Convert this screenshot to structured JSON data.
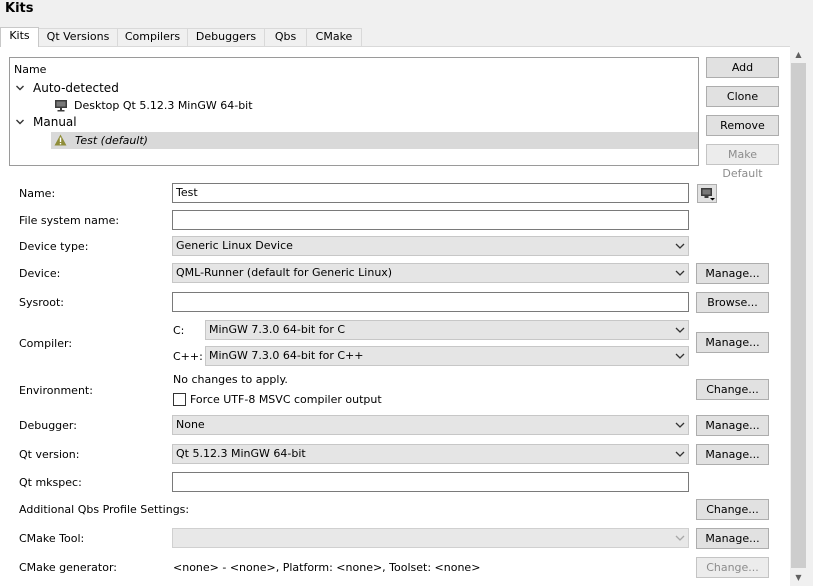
{
  "page": {
    "title": "Kits"
  },
  "tabs": [
    {
      "label": "Kits"
    },
    {
      "label": "Qt Versions"
    },
    {
      "label": "Compilers"
    },
    {
      "label": "Debuggers"
    },
    {
      "label": "Qbs"
    },
    {
      "label": "CMake"
    }
  ],
  "tree": {
    "header": "Name",
    "groups": [
      {
        "label": "Auto-detected",
        "items": [
          {
            "label": "Desktop Qt 5.12.3 MinGW 64-bit",
            "icon": "monitor-icon"
          }
        ]
      },
      {
        "label": "Manual",
        "items": [
          {
            "label": "Test (default)",
            "icon": "warning-icon",
            "selected": true
          }
        ]
      }
    ]
  },
  "actions": {
    "add": "Add",
    "clone": "Clone",
    "remove": "Remove",
    "make_default": "Make Default"
  },
  "form": {
    "name": {
      "label": "Name:",
      "value": "Test"
    },
    "filesystem": {
      "label": "File system name:",
      "value": ""
    },
    "device_type": {
      "label": "Device type:",
      "value": "Generic Linux Device"
    },
    "device": {
      "label": "Device:",
      "value": "QML-Runner (default for Generic Linux)",
      "button": "Manage..."
    },
    "sysroot": {
      "label": "Sysroot:",
      "value": "",
      "button": "Browse..."
    },
    "compiler": {
      "label": "Compiler:",
      "c_label": "C:",
      "c_value": "MinGW 7.3.0 64-bit for C",
      "cpp_label": "C++:",
      "cpp_value": "MinGW 7.3.0 64-bit for C++",
      "button": "Manage..."
    },
    "environment": {
      "label": "Environment:",
      "text": "No changes to apply.",
      "checkbox_label": "Force UTF-8 MSVC compiler output",
      "checked": false,
      "button": "Change..."
    },
    "debugger": {
      "label": "Debugger:",
      "value": "None",
      "button": "Manage..."
    },
    "qt_version": {
      "label": "Qt version:",
      "value": "Qt 5.12.3 MinGW 64-bit",
      "button": "Manage..."
    },
    "mkspec": {
      "label": "Qt mkspec:",
      "value": ""
    },
    "qbs": {
      "label": "Additional Qbs Profile Settings:",
      "button": "Change..."
    },
    "cmake_tool": {
      "label": "CMake Tool:",
      "value": "",
      "button": "Manage..."
    },
    "cmake_generator": {
      "label": "CMake generator:",
      "text": "<none> - <none>, Platform: <none>, Toolset: <none>",
      "button": "Change..."
    }
  },
  "colors": {
    "selection": "#d9d9d9",
    "warning": "#8f8d3a",
    "panel": "#ffffff",
    "window": "#f0f0f0"
  }
}
